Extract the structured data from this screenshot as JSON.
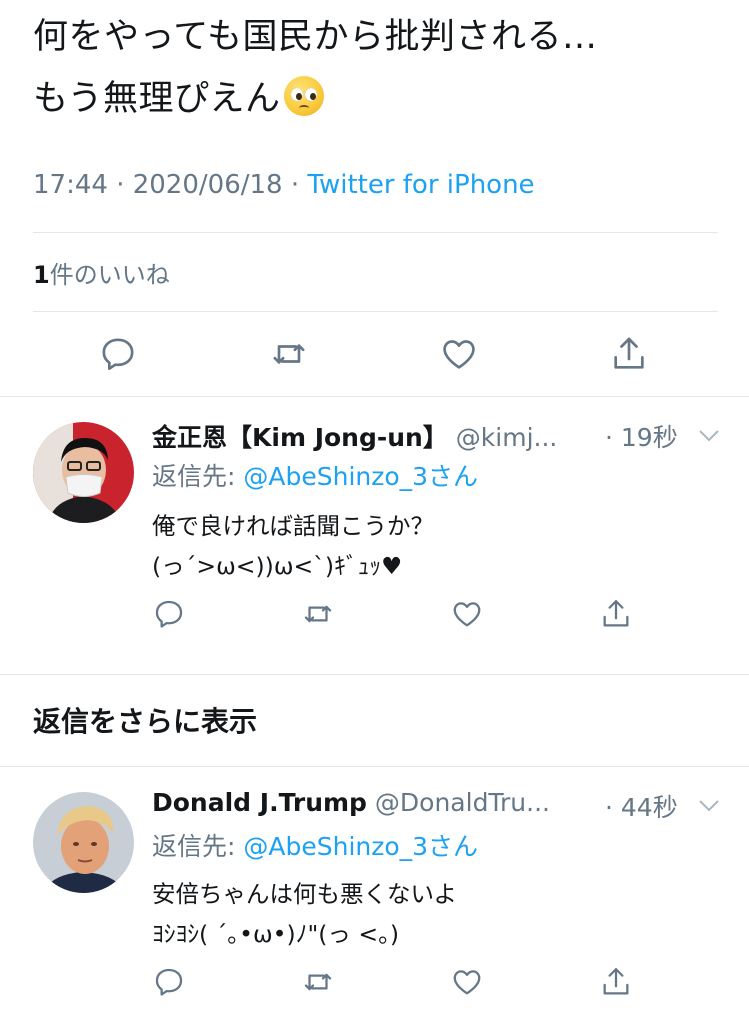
{
  "main_tweet": {
    "text_line1": "何をやっても国民から批判される…",
    "text_line2": "もう無理ぴえん",
    "emoji": "pleading-face-emoji",
    "time": "17:44 · 2020/06/18 · ",
    "client": "Twitter for iPhone",
    "likes_count": "1",
    "likes_label": "件のいいね"
  },
  "icons": {
    "reply": "reply-icon",
    "retweet": "retweet-icon",
    "like": "like-heart-icon",
    "share": "share-icon",
    "chevron": "chevron-down-icon"
  },
  "replies": [
    {
      "name": "金正恩【Kim Jong-un】",
      "handle": "@kimj...",
      "time": "· 19秒",
      "reply_to_label": "返信先: ",
      "reply_to_handle": "@AbeShinzo_3さん",
      "body_line1": "俺で良ければ話聞こうか？",
      "body_line2": "(っ´>ω<))ω<`)ｷﾞｭｯ",
      "heart": "♥"
    },
    {
      "name": "Donald J.Trump",
      "handle": "@DonaldTru...",
      "time": "· 44秒",
      "reply_to_label": "返信先: ",
      "reply_to_handle": "@AbeShinzo_3さん",
      "body_line1": "安倍ちゃんは何も悪くないよ",
      "body_line2": "ﾖｼﾖｼ( ´｡•ω•)ﾉ\"(っ <。)"
    }
  ],
  "show_more_replies": "返信をさらに表示",
  "colors": {
    "accent": "#1da1f2",
    "secondary_text": "#657786",
    "primary_text": "#14171a",
    "divider": "#e1e8ed"
  }
}
